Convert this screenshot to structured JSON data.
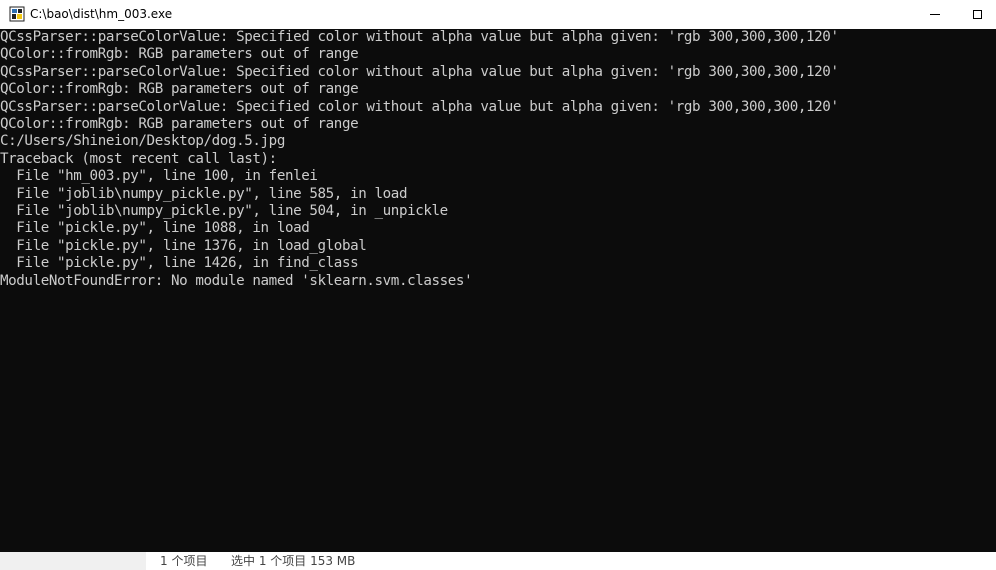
{
  "window": {
    "title": "C:\\bao\\dist\\hm_003.exe",
    "icon": "python-exe-icon",
    "controls": {
      "minimize": "minimize-icon",
      "maximize": "maximize-icon"
    }
  },
  "console": {
    "lines": [
      "QCssParser::parseColorValue: Specified color without alpha value but alpha given: 'rgb 300,300,300,120'",
      "QColor::fromRgb: RGB parameters out of range",
      "QCssParser::parseColorValue: Specified color without alpha value but alpha given: 'rgb 300,300,300,120'",
      "QColor::fromRgb: RGB parameters out of range",
      "QCssParser::parseColorValue: Specified color without alpha value but alpha given: 'rgb 300,300,300,120'",
      "QColor::fromRgb: RGB parameters out of range",
      "C:/Users/Shineion/Desktop/dog.5.jpg",
      "Traceback (most recent call last):",
      "  File \"hm_003.py\", line 100, in fenlei",
      "  File \"joblib\\numpy_pickle.py\", line 585, in load",
      "  File \"joblib\\numpy_pickle.py\", line 504, in _unpickle",
      "  File \"pickle.py\", line 1088, in load",
      "  File \"pickle.py\", line 1376, in load_global",
      "  File \"pickle.py\", line 1426, in find_class",
      "ModuleNotFoundError: No module named 'sklearn.svm.classes'"
    ],
    "colors": {
      "background": "#0c0c0c",
      "text": "#cccccc"
    }
  },
  "statusbar": {
    "item_count": "1 个项目",
    "selected_info": "选中 1 个项目  153 MB"
  }
}
